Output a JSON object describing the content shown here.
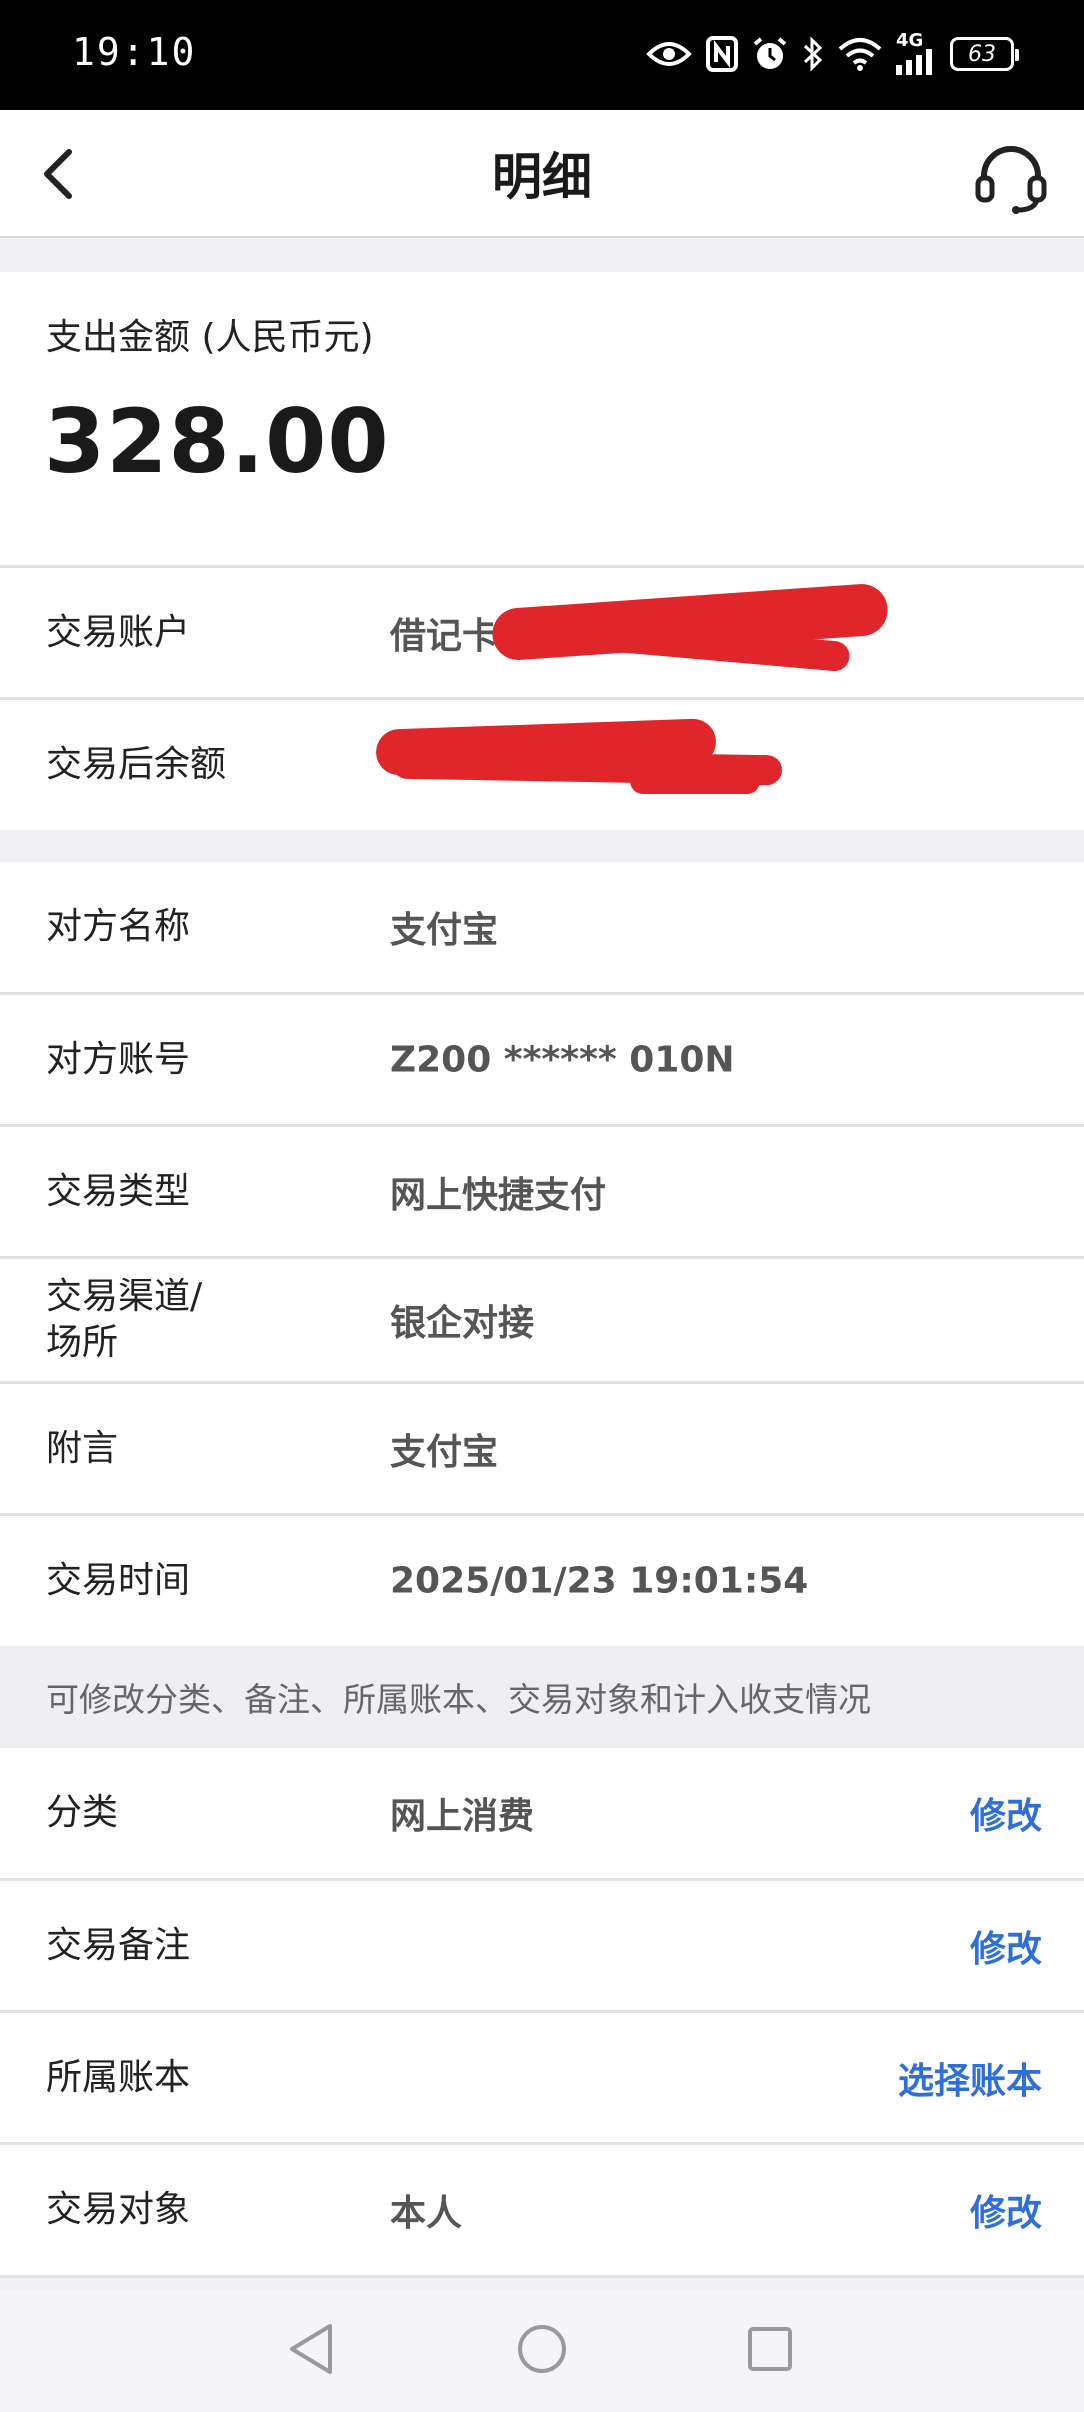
{
  "status_bar": {
    "time": "19:10",
    "battery": "63",
    "network": "4G",
    "icons": [
      "eye-icon",
      "nfc-icon",
      "alarm-icon",
      "bluetooth-icon",
      "wifi-icon",
      "signal-icon",
      "battery-icon"
    ]
  },
  "header": {
    "title": "明细",
    "back_icon": "chevron-left-icon",
    "support_icon": "headset-icon"
  },
  "amount": {
    "label": "支出金额 (人民币元)",
    "value": "328.00"
  },
  "account_section": [
    {
      "key": "交易账户",
      "value": "借记卡",
      "redacted": true
    },
    {
      "key": "交易后余额",
      "value": "",
      "redacted": true
    }
  ],
  "detail_section": [
    {
      "key": "对方名称",
      "value": "支付宝"
    },
    {
      "key": "对方账号",
      "value": "Z200 ****** 010N"
    },
    {
      "key": "交易类型",
      "value": "网上快捷支付"
    },
    {
      "key": "交易渠道/\n场所",
      "value": "银企对接"
    },
    {
      "key": "附言",
      "value": "支付宝"
    },
    {
      "key": "交易时间",
      "value": "2025/01/23 19:01:54"
    }
  ],
  "hint": "可修改分类、备注、所属账本、交易对象和计入收支情况",
  "editable_section": [
    {
      "key": "分类",
      "value": "网上消费",
      "action": "修改"
    },
    {
      "key": "交易备注",
      "value": "",
      "action": "修改"
    },
    {
      "key": "所属账本",
      "value": "",
      "action": "选择账本"
    },
    {
      "key": "交易对象",
      "value": "本人",
      "action": "修改"
    }
  ],
  "colors": {
    "accent": "#2f6fd8",
    "redaction": "#e1262b",
    "background": "#f0f0f4"
  }
}
